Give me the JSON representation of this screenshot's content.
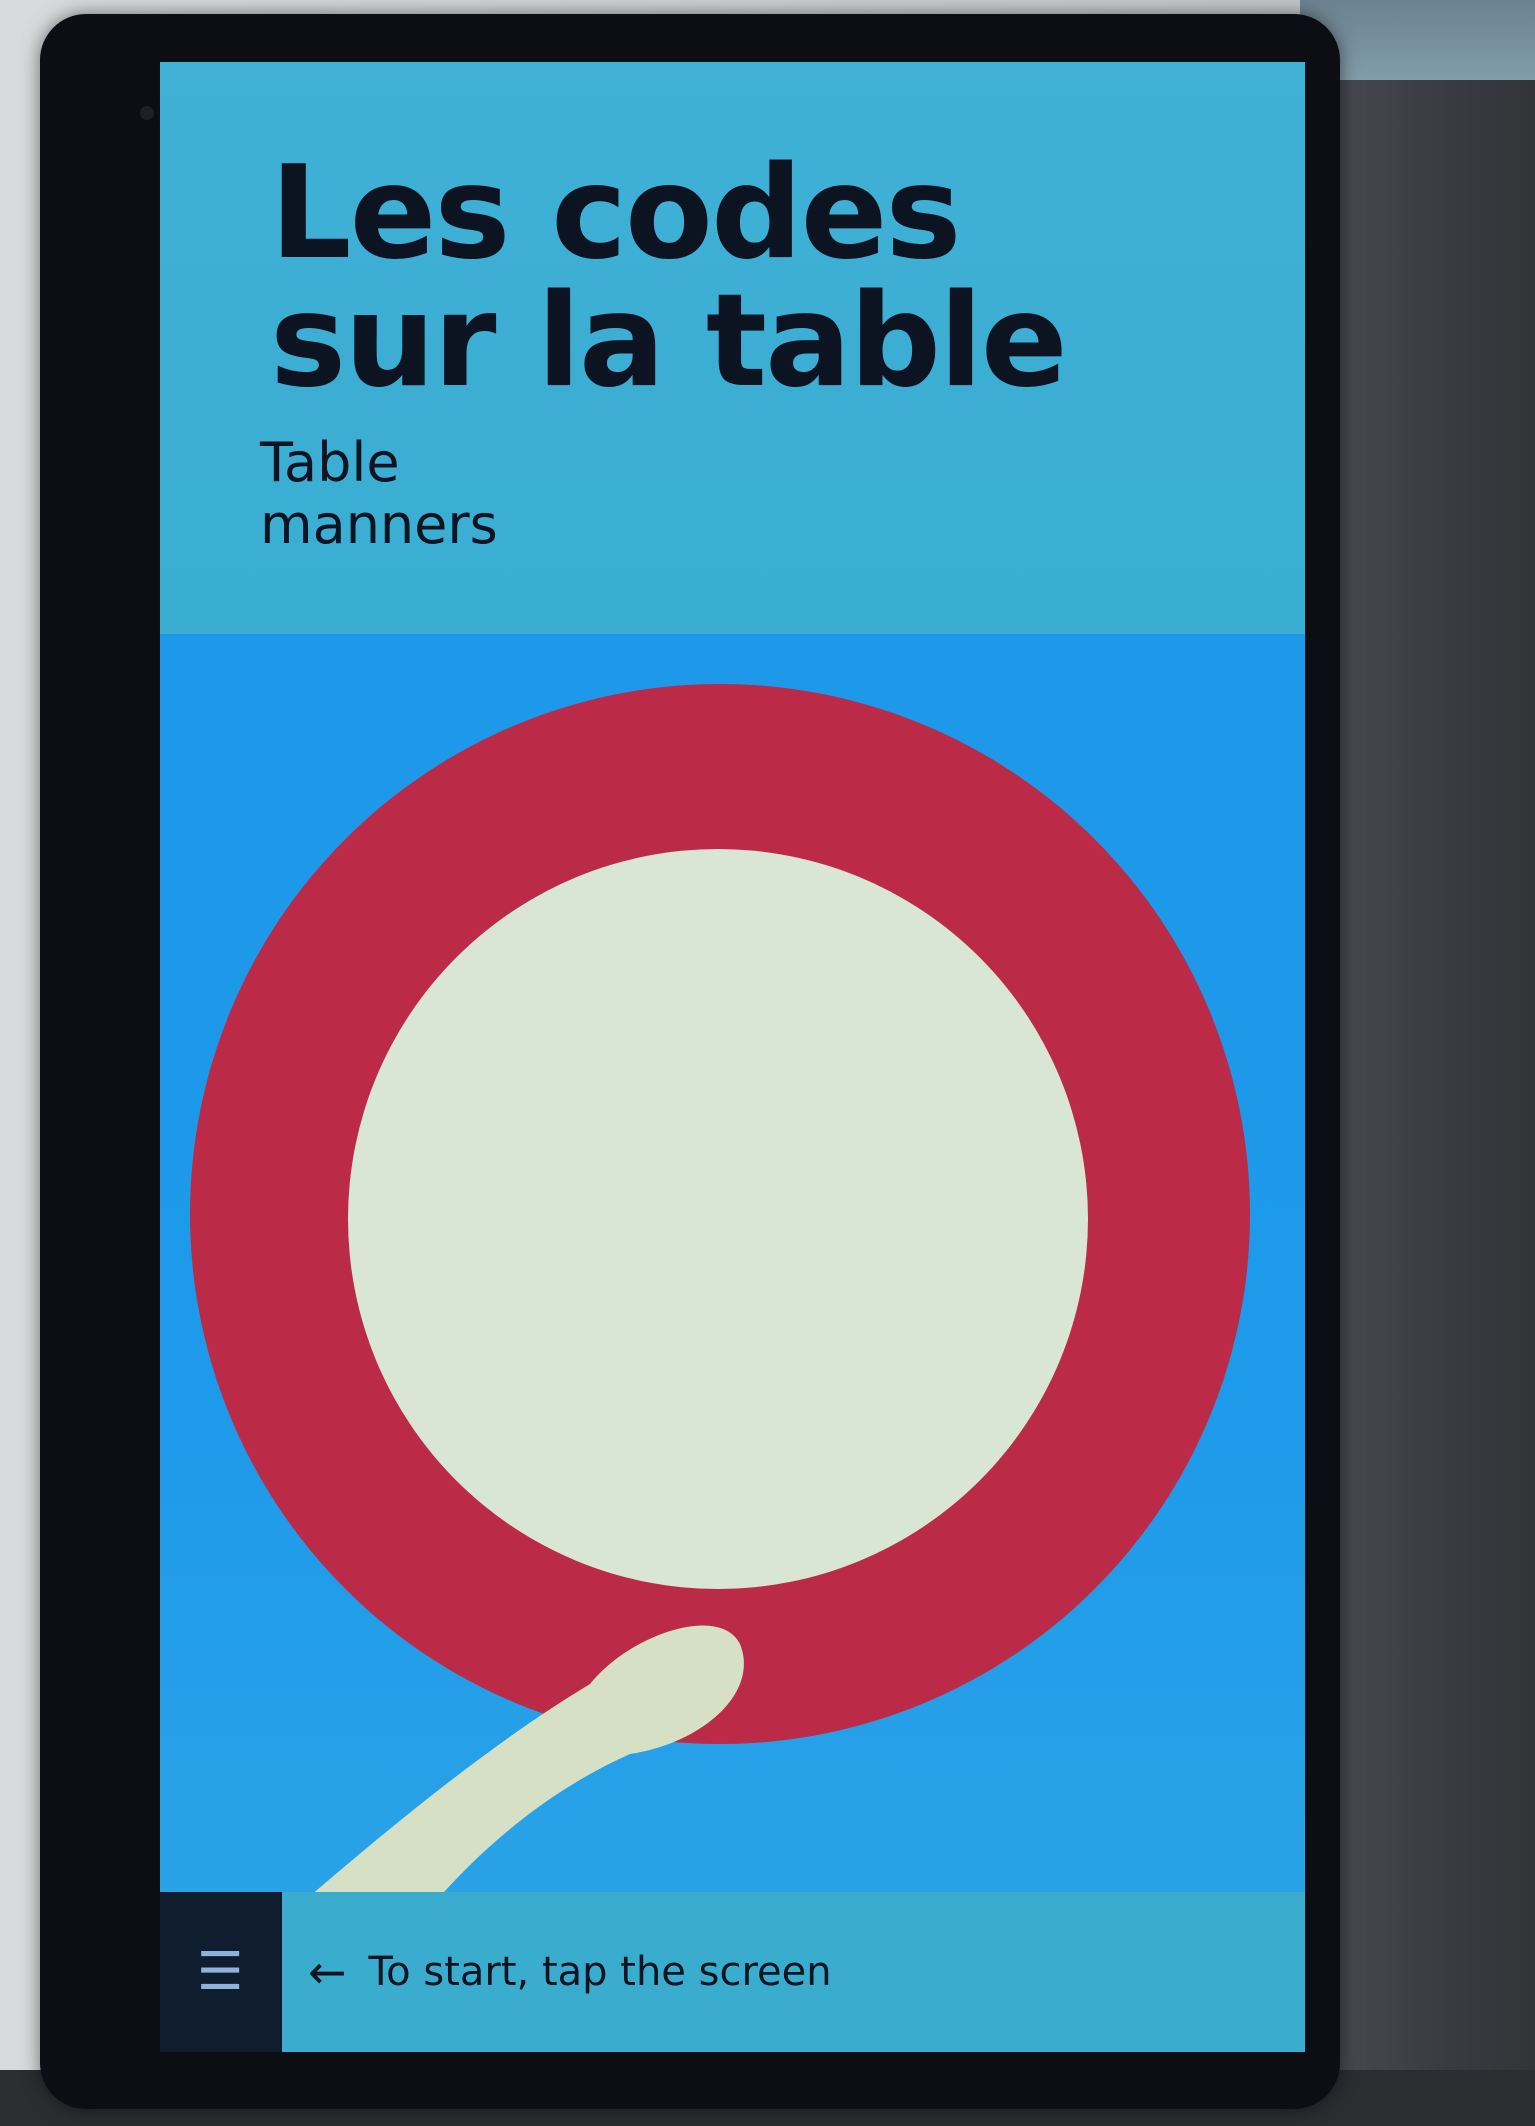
{
  "screen": {
    "title": "Les codes\nsur la table",
    "subtitle": "Table\nmanners"
  },
  "footer": {
    "menu_icon": "☰",
    "arrow_icon": "←",
    "prompt": "To start, tap the screen"
  },
  "colors": {
    "header_background": "#3fb0d6",
    "illustration_background": "#1e98e8",
    "plate_rim": "#bb2b48",
    "plate_center": "#d9e6d4",
    "spoon": "#d6e0c4",
    "text": "#0c1422"
  }
}
